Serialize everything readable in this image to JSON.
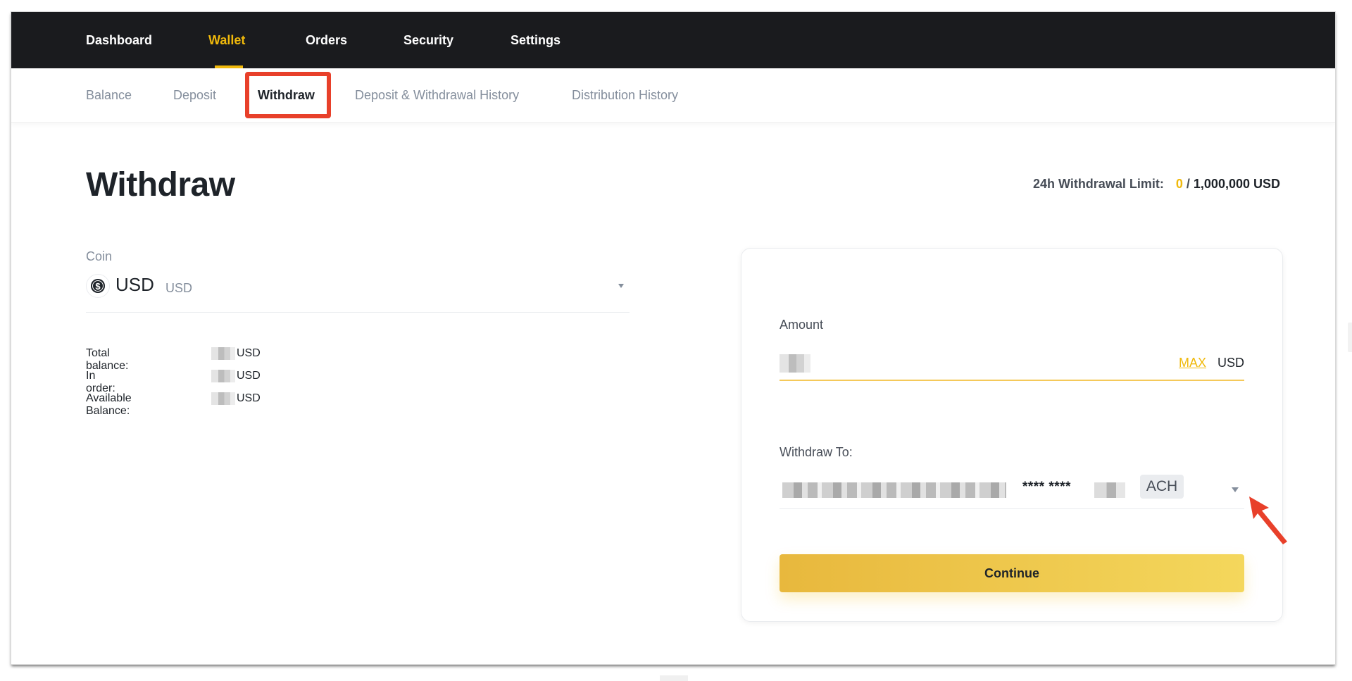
{
  "topnav": {
    "items": [
      {
        "label": "Dashboard",
        "active": false
      },
      {
        "label": "Wallet",
        "active": true
      },
      {
        "label": "Orders",
        "active": false
      },
      {
        "label": "Security",
        "active": false
      },
      {
        "label": "Settings",
        "active": false
      }
    ]
  },
  "subnav": {
    "items": [
      {
        "label": "Balance",
        "active": false
      },
      {
        "label": "Deposit",
        "active": false
      },
      {
        "label": "Withdraw",
        "active": true
      },
      {
        "label": "Deposit & Withdrawal History",
        "active": false
      },
      {
        "label": "Distribution History",
        "active": false
      }
    ]
  },
  "page": {
    "title": "Withdraw",
    "limit": {
      "label": "24h Withdrawal Limit:",
      "used": "0",
      "separator": "/",
      "max": "1,000,000 USD"
    }
  },
  "coin": {
    "label": "Coin",
    "icon": "dollar-coin-icon",
    "icon_glyph": "$",
    "symbol": "USD",
    "name": "USD"
  },
  "balances": [
    {
      "label": "Total balance:",
      "value": "",
      "unit": "USD"
    },
    {
      "label": "In order:",
      "value": "",
      "unit": "USD"
    },
    {
      "label": "Available Balance:",
      "value": "",
      "unit": "USD"
    }
  ],
  "form": {
    "amount_label": "Amount",
    "amount_value": "",
    "max_label": "MAX",
    "amount_unit": "USD",
    "withdraw_to_label": "Withdraw To:",
    "account_masked": "**** ****",
    "account_type": "ACH",
    "continue_label": "Continue"
  },
  "colors": {
    "accent": "#f0b90b",
    "header_bg": "#1a1b1e",
    "annotation": "#e8402a"
  }
}
